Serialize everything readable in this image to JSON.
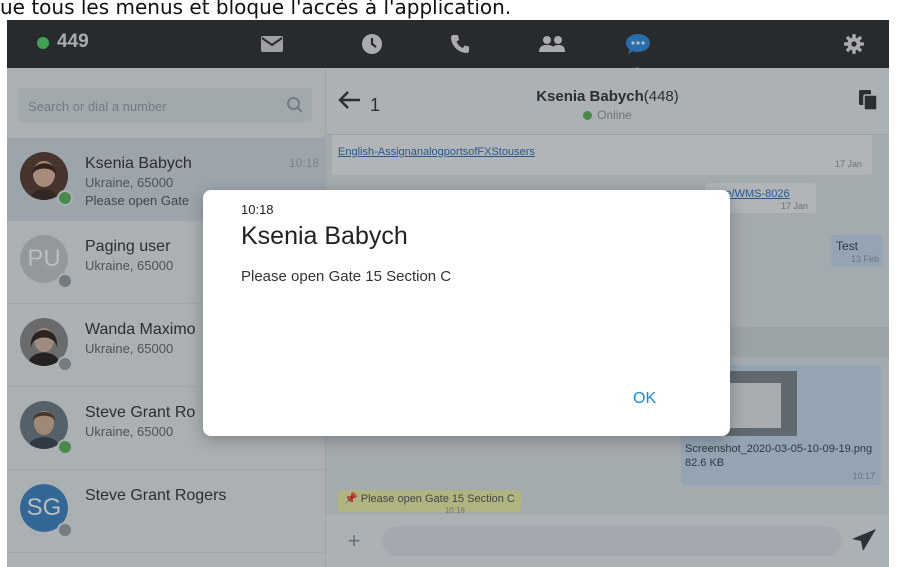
{
  "caption": "ue tous les menus et bloque l'accès à l'application.",
  "topbar": {
    "extension": "449",
    "status_color": "#4cd964",
    "icons": [
      "mail-icon",
      "clock-icon",
      "phone-icon",
      "contacts-icon",
      "chat-icon",
      "gear-icon"
    ]
  },
  "search": {
    "placeholder": "Search or dial a number"
  },
  "contacts": [
    {
      "name": "Ksenia Babych",
      "location": "Ukraine, 65000",
      "last_message": "Please open Gate",
      "time": "10:18",
      "presence": "#5cb85c"
    },
    {
      "name": "Paging user",
      "location": "Ukraine, 65000",
      "initials": "PU",
      "presence": "#9aa3aa"
    },
    {
      "name": "Wanda Maximo",
      "location": "Ukraine, 65000",
      "presence": "#9aa3aa"
    },
    {
      "name": "Steve Grant Ro",
      "location": "Ukraine, 65000",
      "presence": "#5cb85c"
    },
    {
      "name": "Steve Grant Rogers",
      "initials": "SG",
      "presence": "#9aa3aa"
    }
  ],
  "chat": {
    "back_count": "1",
    "contact_name": "Ksenia Babych",
    "contact_ext": "(448)",
    "status": "Online"
  },
  "messages": {
    "link_line1": "English-AssignanalogportsofFXStousers",
    "link_date": "17 Jan",
    "link2": "wse/WMS-8026",
    "link2_date": "17 Jan",
    "test_text": "Test",
    "test_date": "13 Feb",
    "file_name": "Screenshot_2020-03-05-10-09-19.png",
    "file_size": "82.6 KB",
    "file_time": "10:17",
    "pinned": "Please open Gate 15 Section C",
    "pinned_time": "10:18"
  },
  "dialog": {
    "time": "10:18",
    "title": "Ksenia Babych",
    "body": "Please open Gate 15 Section C",
    "ok_label": "OK"
  }
}
